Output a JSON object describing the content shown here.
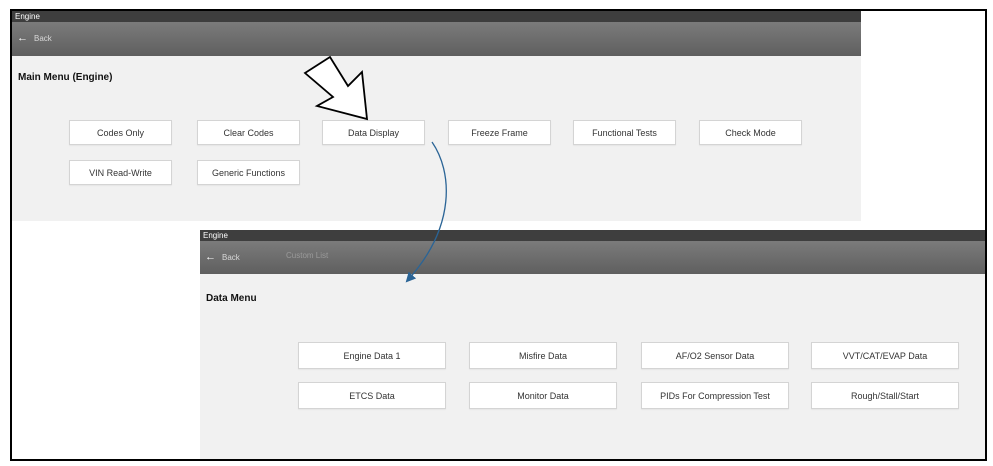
{
  "main": {
    "title": "Engine",
    "back_label": "Back",
    "heading": "Main Menu (Engine)",
    "buttons": [
      "Codes Only",
      "Clear Codes",
      "Data Display",
      "Freeze Frame",
      "Functional Tests",
      "Check Mode",
      "VIN Read-Write",
      "Generic Functions"
    ]
  },
  "data_menu": {
    "title": "Engine",
    "back_label": "Back",
    "breadcrumb": "Custom List",
    "heading": "Data Menu",
    "buttons": [
      "Engine Data 1",
      "Misfire Data",
      "AF/O2 Sensor Data",
      "VVT/CAT/EVAP Data",
      "ETCS Data",
      "Monitor Data",
      "PIDs For Compression Test",
      "Rough/Stall/Start"
    ]
  },
  "colors": {
    "title_bar": "#3e3e3e",
    "toolbar": "#6b6b6b",
    "callout_arrow": "#2a6496"
  }
}
